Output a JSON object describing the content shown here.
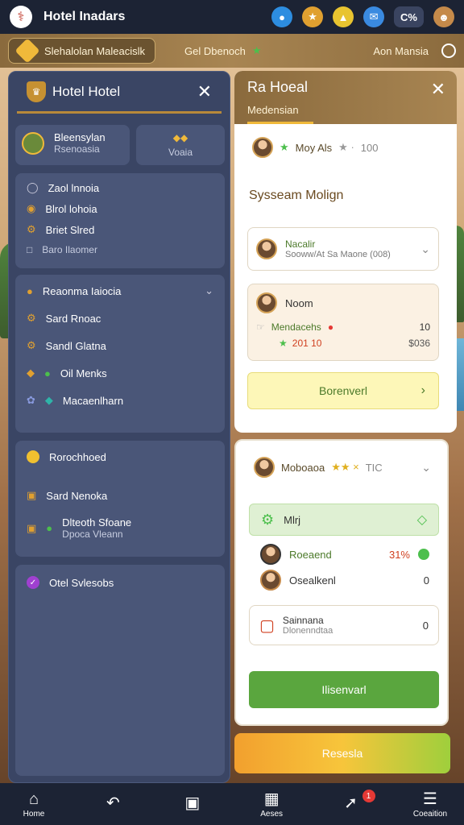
{
  "topbar": {
    "title": "Hotel Inadars",
    "counter": "C%"
  },
  "secondbar": {
    "hotel_chip": "Slehalolan Maleacislk",
    "middle": "Gel Dbenoch",
    "right": "Aon Mansia"
  },
  "left_panel": {
    "title": "Hotel Hotel",
    "profile": {
      "name": "Bleensylan",
      "sub": "Rsenoasia"
    },
    "side_button": {
      "label": "Voaia"
    },
    "group1": [
      "Zaol lnnoia",
      "Blrol lohoia",
      "Briet Slred",
      "Baro Ilaomer"
    ],
    "group2_header": "Reaonma Iaiocia",
    "group2": [
      "Sard Rnoac",
      "Sandl Glatna",
      "Oil Menks",
      "Macaenlharn"
    ],
    "group3_header": "Rorochhoed",
    "group3": [
      "Sard Nenoka",
      "Dlteoth Sfoane"
    ],
    "group3_sub": "Dpoca Vleann",
    "group4": "Otel Svlesobs"
  },
  "right_panel": {
    "title": "Ra Hoeal",
    "subtitle": "Medensian",
    "top_row": {
      "text": "Moy Als",
      "value": "100"
    },
    "section_title": "Sysseam Molign",
    "dropdown": {
      "title": "Nacalir",
      "sub": "Sooww/At Sa Maone (008)"
    },
    "info_card": {
      "name": "Noom",
      "label": "Mendacehs",
      "count": "10",
      "tags": "201 10",
      "price": "$036"
    },
    "forward_button": "Borenverl"
  },
  "right_panel2": {
    "header": "Moboaoa",
    "header_extra": "TIC",
    "green_row": "Mlrj",
    "rows": [
      {
        "name": "Roeaend",
        "value": "31%"
      },
      {
        "name": "Osealkenl",
        "value": "0"
      }
    ],
    "service": {
      "title": "Sainnana",
      "sub": "Dlonenndtaa",
      "value": "0"
    },
    "reserve_button": "Ilisenvarl"
  },
  "reserve_main_button": "Resesla",
  "bottom_nav": [
    {
      "icon": "home-icon",
      "label": "Home"
    },
    {
      "icon": "back-icon",
      "label": ""
    },
    {
      "icon": "square-icon",
      "label": ""
    },
    {
      "icon": "calendar-icon",
      "label": "Aeses"
    },
    {
      "icon": "compass-icon",
      "label": "",
      "badge": "1"
    },
    {
      "icon": "settings-icon",
      "label": "Coeaition"
    }
  ]
}
